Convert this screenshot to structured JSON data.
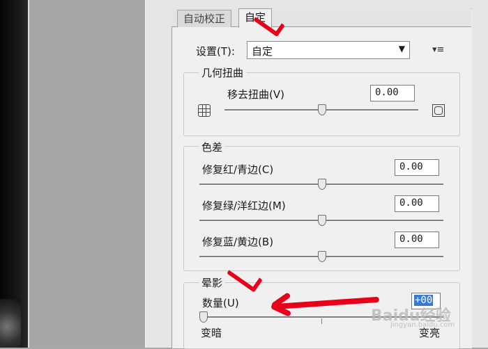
{
  "tabs": [
    {
      "label": "自动校正"
    },
    {
      "label": "自定"
    }
  ],
  "settings": {
    "label": "设置(T):",
    "value": "自定",
    "menu_icon": "menu-icon"
  },
  "geometric": {
    "title": "几何扭曲",
    "remove_label": "移去扭曲(V)",
    "remove_value": "0.00",
    "remove_level": 0.5,
    "left_icon": "barrel-grid-icon",
    "right_icon": "pincushion-icon"
  },
  "chromatic": {
    "title": "色差",
    "items": [
      {
        "label": "修复红/青边(C)",
        "value": "0.00",
        "level": 0.5
      },
      {
        "label": "修复绿/洋红边(M)",
        "value": "0.00",
        "level": 0.5
      },
      {
        "label": "修复蓝/黄边(B)",
        "value": "0.00",
        "level": 0.5
      }
    ]
  },
  "vignette": {
    "title": "晕影",
    "amount_label": "数量(U)",
    "amount_value": "+00",
    "amount_level": 0.0,
    "min_label": "变暗",
    "max_label": "变亮"
  },
  "watermark": {
    "text": "Baidu经验",
    "sub": "jingyan.baidu.com"
  },
  "colors": {
    "annotation": "#e8001a",
    "selection": "#3a78d6",
    "panel": "#f0f0f0"
  }
}
